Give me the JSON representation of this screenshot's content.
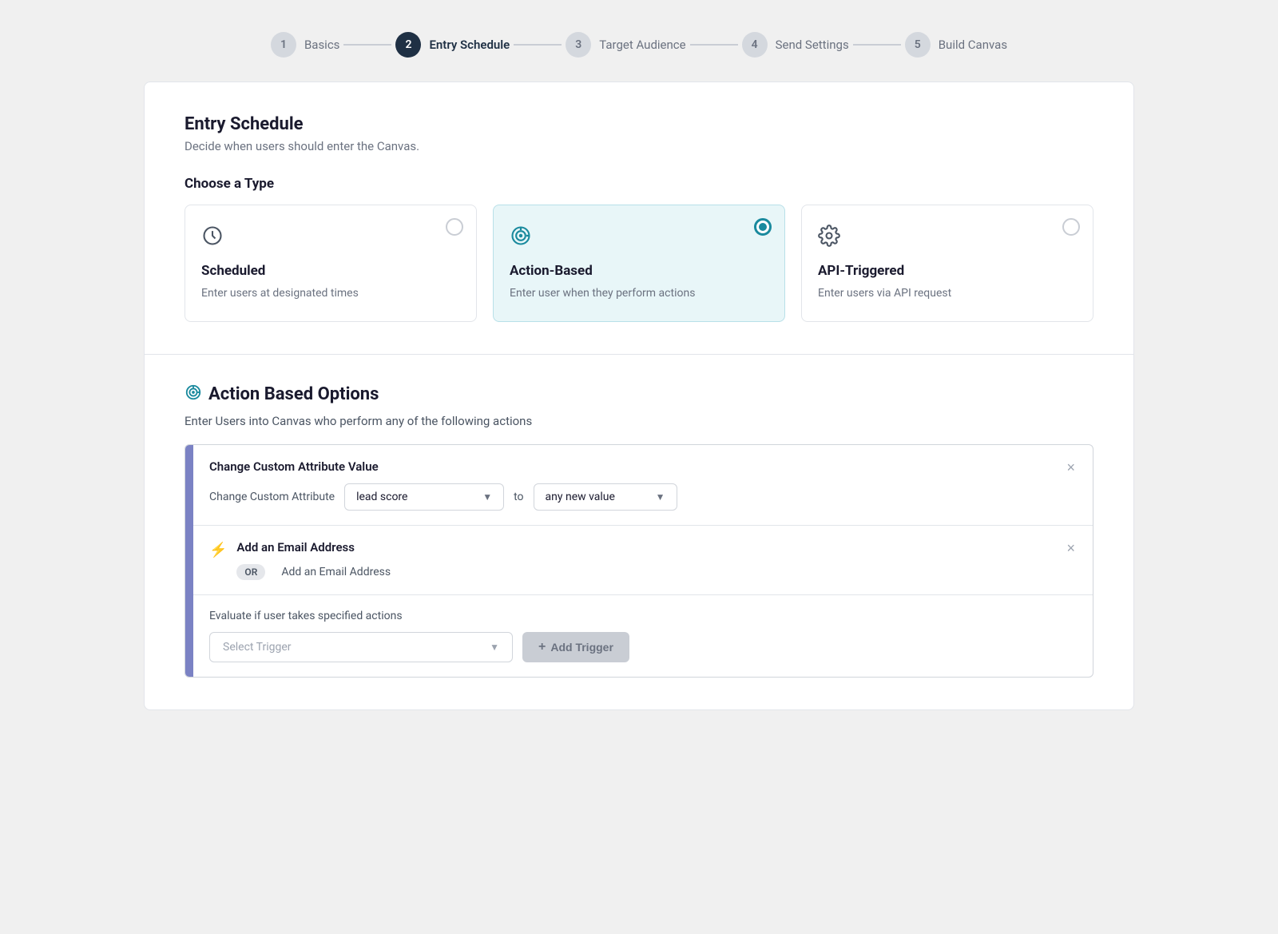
{
  "stepper": {
    "steps": [
      {
        "number": "1",
        "label": "Basics",
        "state": "inactive"
      },
      {
        "number": "2",
        "label": "Entry Schedule",
        "state": "active"
      },
      {
        "number": "3",
        "label": "Target Audience",
        "state": "inactive"
      },
      {
        "number": "4",
        "label": "Send Settings",
        "state": "inactive"
      },
      {
        "number": "5",
        "label": "Build Canvas",
        "state": "inactive"
      }
    ]
  },
  "entry_schedule": {
    "title": "Entry Schedule",
    "subtitle": "Decide when users should enter the Canvas.",
    "choose_type_label": "Choose a Type"
  },
  "type_cards": [
    {
      "id": "scheduled",
      "name": "Scheduled",
      "desc": "Enter users at designated times",
      "selected": false
    },
    {
      "id": "action-based",
      "name": "Action-Based",
      "desc": "Enter user when they perform actions",
      "selected": true
    },
    {
      "id": "api-triggered",
      "name": "API-Triggered",
      "desc": "Enter users via API request",
      "selected": false
    }
  ],
  "action_options": {
    "section_title": "Action Based Options",
    "description": "Enter Users into Canvas who perform any of the following actions",
    "actions": [
      {
        "id": "change-custom-attribute",
        "title": "Change Custom Attribute Value",
        "type": "dropdown-row",
        "label": "Change Custom Attribute",
        "attribute_value": "lead score",
        "connector": "to",
        "value_dropdown": "any new value"
      },
      {
        "id": "add-email",
        "title": "Add an Email Address",
        "type": "or-row",
        "or_label": "OR",
        "text": "Add an Email Address"
      }
    ],
    "trigger": {
      "desc": "Evaluate if user takes specified actions",
      "placeholder": "Select Trigger",
      "add_button": "+ Add Trigger"
    }
  }
}
